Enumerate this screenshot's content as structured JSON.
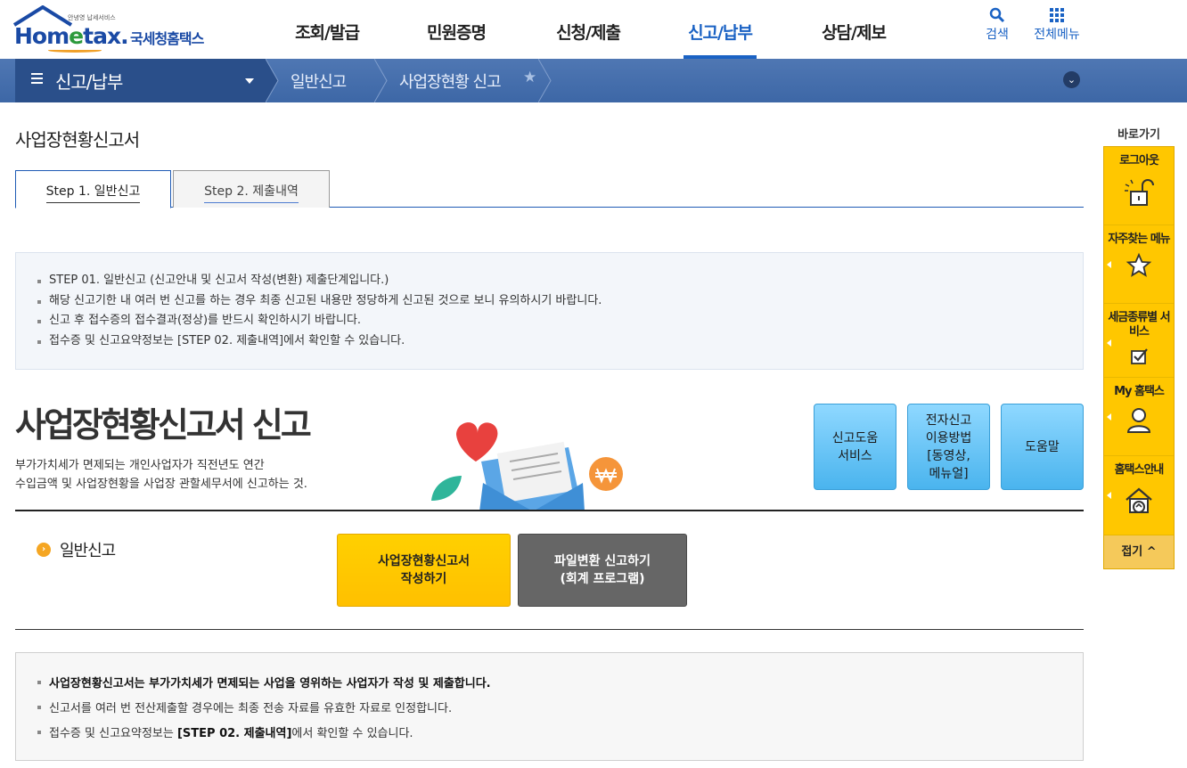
{
  "header": {
    "logo_tagline": "안녕영 납세서비스",
    "logo_brand_home": "Hom",
    "logo_brand_e": "e",
    "logo_brand_tax": "tax.",
    "logo_korean": "국세청홈택스",
    "nav": [
      "조회/발급",
      "민원증명",
      "신청/제출",
      "신고/납부",
      "상담/제보"
    ],
    "active_nav": "신고/납부",
    "search_label": "검색",
    "all_menu_label": "전체메뉴"
  },
  "location": {
    "home_label": "신고/납부",
    "crumb1": "일반신고",
    "crumb2": "사업장현황 신고"
  },
  "page": {
    "title": "사업장현황신고서",
    "tabs": [
      "Step 1. 일반신고",
      "Step 2. 제출내역"
    ],
    "notice1": [
      "STEP 01. 일반신고 (신고안내 및 신고서 작성(변환) 제출단계입니다.)",
      "해당 신고기한 내 여러 번 신고를 하는 경우 최종 신고된 내용만 정당하게 신고된 것으로 보니 유의하시기 바랍니다.",
      "신고 후 접수증의 접수결과(정상)를 반드시 확인하시기 바랍니다.",
      "접수증 및 신고요약정보는 [STEP 02. 제출내역]에서 확인할 수 있습니다."
    ],
    "big_title": "사업장현황신고서 신고",
    "desc_line1": "부가가치세가 면제되는 개인사업자가 직전년도 연간",
    "desc_line2": "수입금액 및 사업장현황을 사업장 관할세무서에 신고하는 것.",
    "quick_buttons": [
      {
        "l1": "신고도움",
        "l2": "서비스"
      },
      {
        "l1": "전자신고",
        "l2": "이용방법",
        "l3": "[동영상,",
        "l4": "메뉴얼]"
      },
      {
        "l1": "도움말"
      }
    ],
    "general_label": "일반신고",
    "write_btn_l1": "사업장현황신고서",
    "write_btn_l2": "작성하기",
    "file_btn_l1": "파일변환 신고하기",
    "file_btn_l2": "(회계 프로그램)",
    "notice2": [
      {
        "bold": "사업장현황신고서는 부가가치세가 면제되는 사업을 영위하는 사업자가 작성 및 제출합니다.",
        "pre": "",
        "post": ""
      },
      {
        "bold": "",
        "pre": "신고서를 여러 번 전산제출할 경우에는 최종 전송 자료를 유효한 자료로 인정합니다.",
        "post": ""
      },
      {
        "bold": "[STEP 02. 제출내역]",
        "pre": "접수증 및 신고요약정보는 ",
        "post": "에서 확인할 수 있습니다."
      }
    ]
  },
  "quick_menu": {
    "head": "바로가기",
    "items": [
      {
        "label": "로그아웃",
        "icon": "unlock-icon"
      },
      {
        "label": "자주찾는 메뉴",
        "icon": "star-icon"
      },
      {
        "label": "세금종류별 서비스",
        "icon": "checkbox-icon"
      },
      {
        "label": "My 홈택스",
        "icon": "user-icon"
      },
      {
        "label": "홈택스안내",
        "icon": "home-guide-icon"
      }
    ],
    "fold_label": "접기",
    "fold_arrow": "^"
  },
  "colors": {
    "brand_blue": "#1a62c4",
    "loc_bar": "#3d67a6",
    "yellow": "#ffc700",
    "sky": "#4ab4ee"
  }
}
